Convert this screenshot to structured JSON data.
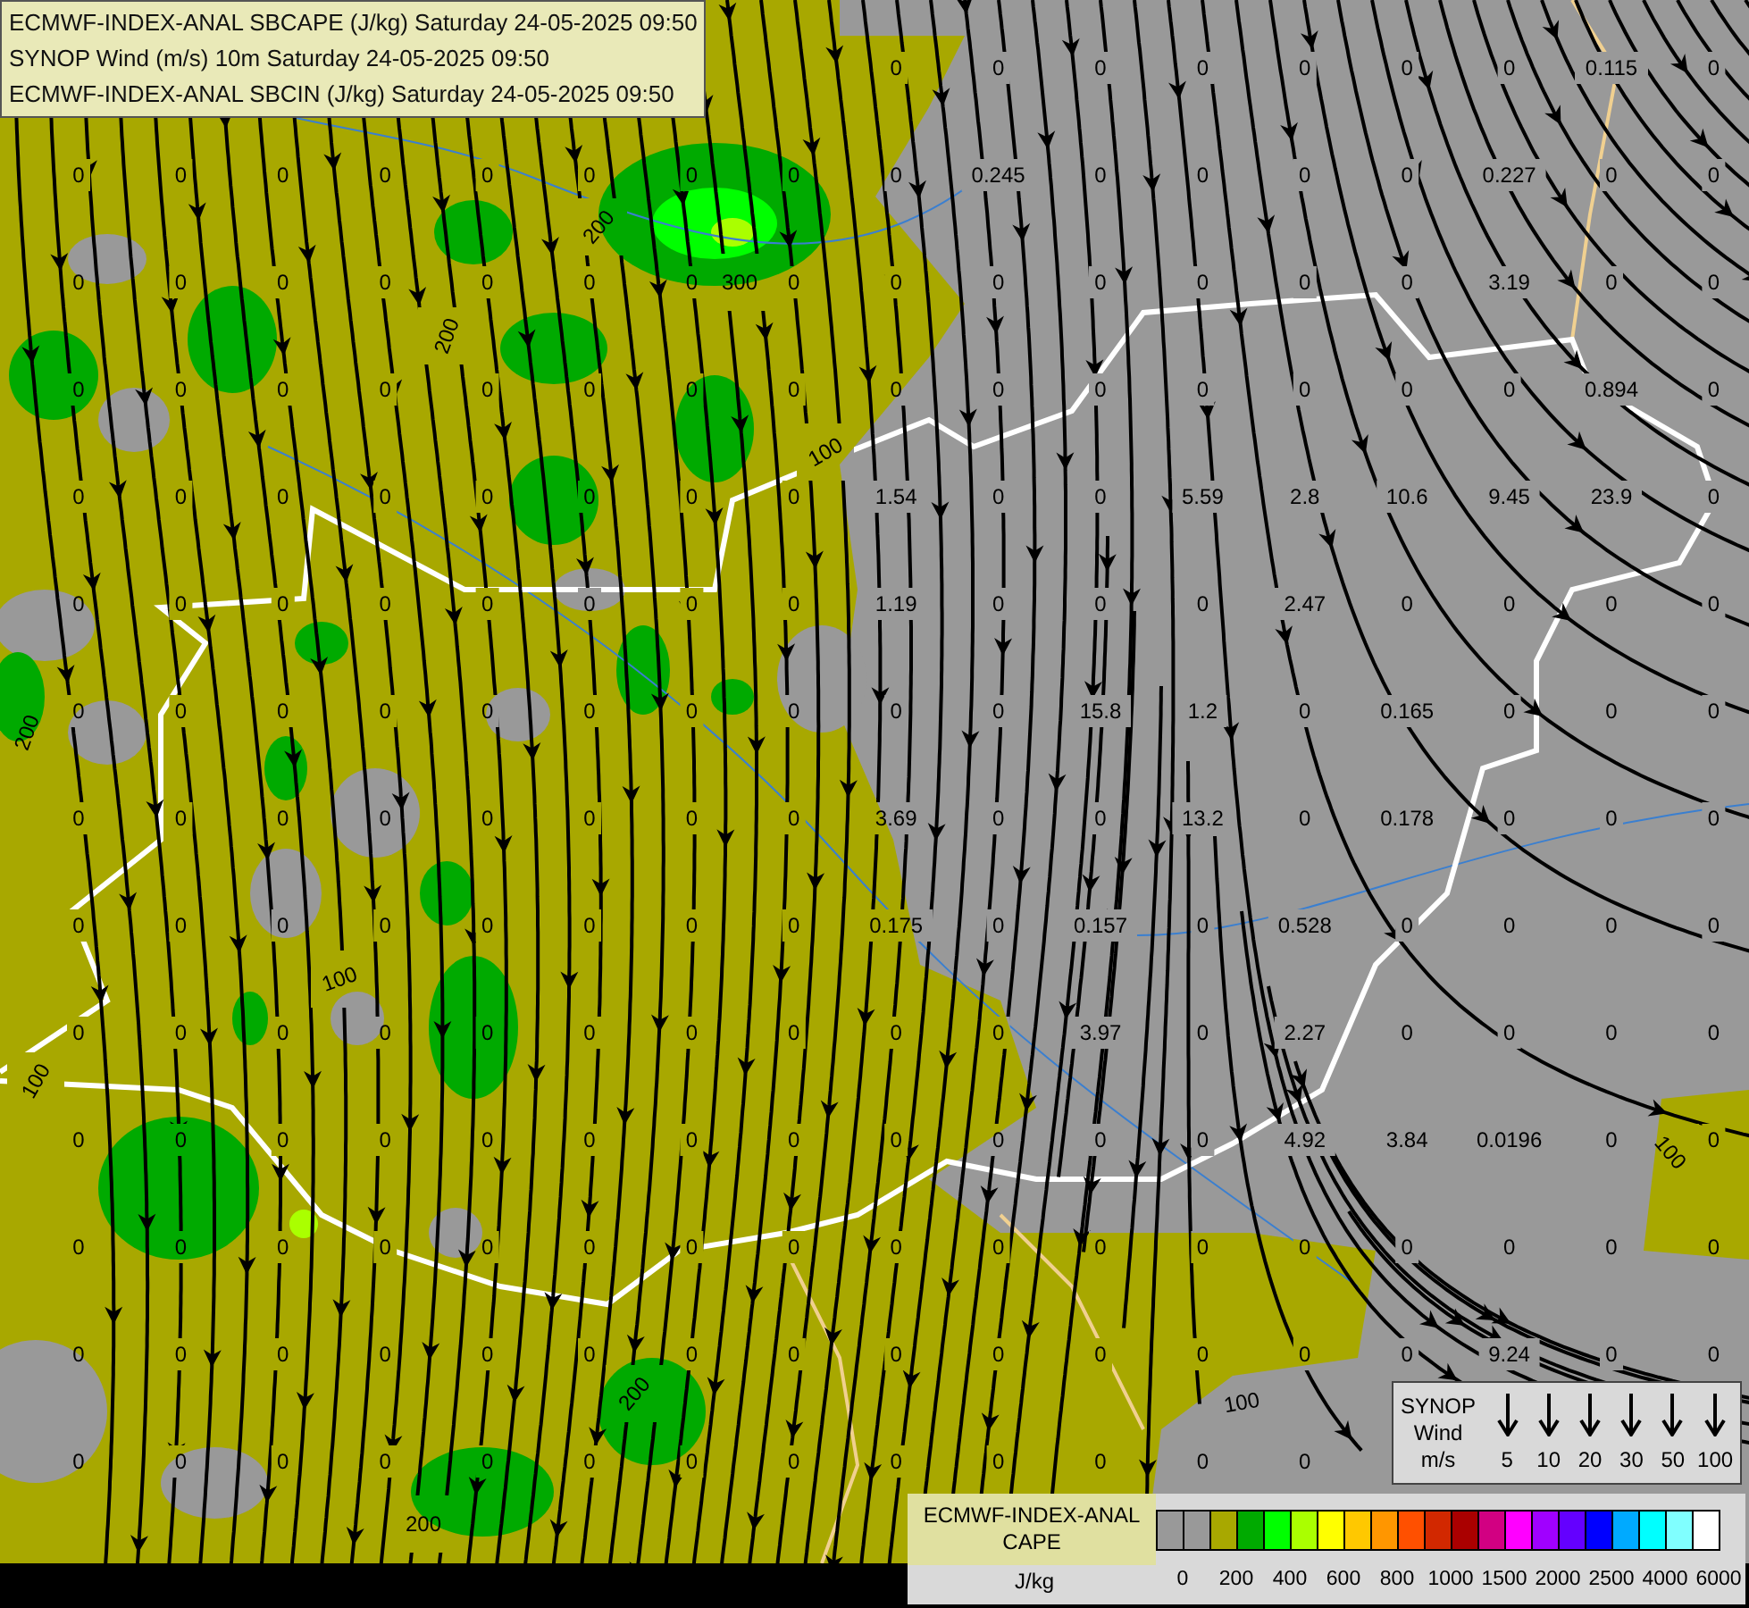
{
  "header": {
    "lines": [
      "ECMWF-INDEX-ANAL SBCAPE (J/kg) Saturday 24-05-2025 09:50",
      "SYNOP Wind (m/s) 10m Saturday 24-05-2025 09:50",
      "ECMWF-INDEX-ANAL SBCIN (J/kg) Saturday 24-05-2025 09:50"
    ]
  },
  "station_values": [
    {
      "values": [
        "0",
        "0",
        "0",
        "0",
        "0",
        "0",
        "0",
        "0.115",
        "0"
      ]
    },
    {
      "values": [
        "0",
        "0",
        "0",
        "0",
        "0",
        "0",
        "0",
        "0",
        "0",
        "0.245",
        "0",
        "0",
        "0",
        "0",
        "0.227",
        "0",
        "0"
      ]
    },
    {
      "values": [
        "0",
        "0",
        "0",
        "0",
        "0",
        "0",
        "0",
        "0",
        "0",
        "0",
        "0",
        "0",
        "0",
        "0",
        "3.19",
        "0",
        "0"
      ]
    },
    {
      "values": [
        "0",
        "0",
        "0",
        "0",
        "0",
        "0",
        "0",
        "0",
        "0",
        "0",
        "0",
        "0",
        "0",
        "0",
        "0",
        "0.894",
        "0"
      ]
    },
    {
      "values": [
        "0",
        "0",
        "0",
        "0",
        "0",
        "0",
        "0",
        "0",
        "1.54",
        "0",
        "0",
        "5.59",
        "2.8",
        "10.6",
        "9.45",
        "23.9",
        "0"
      ]
    },
    {
      "values": [
        "0",
        "0",
        "0",
        "0",
        "0",
        "0",
        "0",
        "0",
        "1.19",
        "0",
        "0",
        "0",
        "2.47",
        "0",
        "0",
        "0",
        "0"
      ]
    },
    {
      "values": [
        "0",
        "0",
        "0",
        "0",
        "0",
        "0",
        "0",
        "0",
        "0",
        "0",
        "15.8",
        "1.2",
        "0",
        "0.165",
        "0",
        "0",
        "0"
      ]
    },
    {
      "values": [
        "0",
        "0",
        "0",
        "0",
        "0",
        "0",
        "0",
        "0",
        "3.69",
        "0",
        "0",
        "13.2",
        "0",
        "0.178",
        "0",
        "0",
        "0"
      ]
    },
    {
      "values": [
        "0",
        "0",
        "0",
        "0",
        "0",
        "0",
        "0",
        "0",
        "0.175",
        "0",
        "0.157",
        "0",
        "0.528",
        "0",
        "0",
        "0",
        "0"
      ]
    },
    {
      "values": [
        "0",
        "0",
        "0",
        "0",
        "0",
        "0",
        "0",
        "0",
        "0",
        "0",
        "3.97",
        "0",
        "2.27",
        "0",
        "0",
        "0",
        "0"
      ]
    },
    {
      "values": [
        "0",
        "0",
        "0",
        "0",
        "0",
        "0",
        "0",
        "0",
        "0",
        "0",
        "0",
        "0",
        "4.92",
        "3.84",
        "0.0196",
        "0",
        "0"
      ]
    },
    {
      "values": [
        "0",
        "0",
        "0",
        "0",
        "0",
        "0",
        "0",
        "0",
        "0",
        "0",
        "0",
        "0",
        "0",
        "0",
        "0",
        "0",
        "0"
      ]
    },
    {
      "values": [
        "0",
        "0",
        "0",
        "0",
        "0",
        "0",
        "0",
        "0",
        "0",
        "0",
        "0",
        "0",
        "0",
        "0",
        "9.24",
        "0",
        "0"
      ]
    },
    {
      "values": [
        "0",
        "0",
        "0",
        "0",
        "0",
        "0",
        "0",
        "0",
        "0",
        "0",
        "0",
        "0",
        "0"
      ]
    }
  ],
  "contour_labels": [
    "200",
    "200",
    "100",
    "300",
    "200",
    "200",
    "100",
    "100",
    "100",
    "200",
    "100"
  ],
  "wind_legend": {
    "title_lines": [
      "SYNOP",
      "Wind"
    ],
    "unit": "m/s",
    "speeds": [
      "5",
      "10",
      "20",
      "30",
      "50",
      "100"
    ]
  },
  "cape_legend": {
    "title_lines": [
      "ECMWF-INDEX-ANAL",
      "CAPE"
    ],
    "unit": "J/kg",
    "swatches": [
      {
        "color": "#999999"
      },
      {
        "color": "#999999"
      },
      {
        "color": "#a8a800"
      },
      {
        "color": "#00aa00"
      },
      {
        "color": "#00ff00"
      },
      {
        "color": "#aaff00"
      },
      {
        "color": "#ffff00"
      },
      {
        "color": "#ffc800"
      },
      {
        "color": "#ff9600"
      },
      {
        "color": "#ff5000"
      },
      {
        "color": "#d22800"
      },
      {
        "color": "#aa0000"
      },
      {
        "color": "#d20082"
      },
      {
        "color": "#ff00ff"
      },
      {
        "color": "#a000ff"
      },
      {
        "color": "#6400ff"
      },
      {
        "color": "#0000ff"
      },
      {
        "color": "#00aaff"
      },
      {
        "color": "#00ffff"
      },
      {
        "color": "#80ffff"
      },
      {
        "color": "#ffffff"
      }
    ],
    "labels": [
      "0",
      "200",
      "400",
      "600",
      "800",
      "1000",
      "1500",
      "2000",
      "2500",
      "4000",
      "6000"
    ]
  }
}
